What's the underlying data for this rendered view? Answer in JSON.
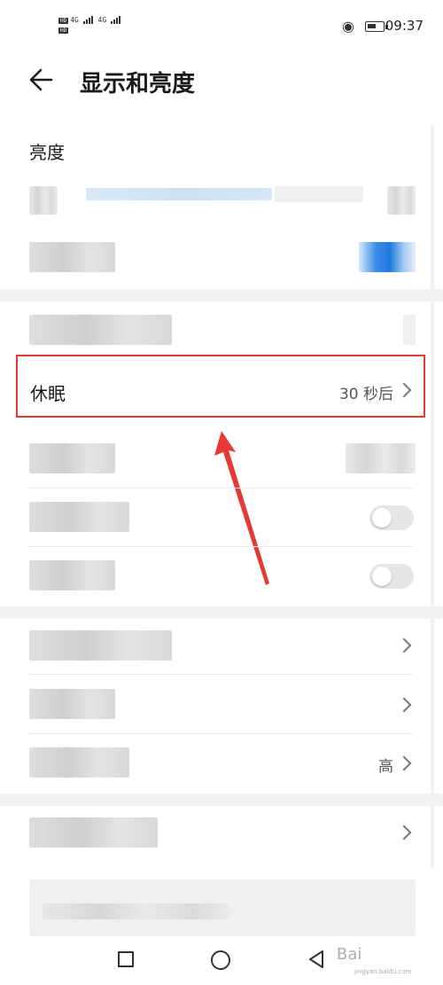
{
  "status_bar": {
    "hd1": "HD",
    "hd2": "HD",
    "net1": "4G",
    "net2": "4G",
    "time": "09:37",
    "icons": [
      "eye-icon",
      "battery-icon",
      "signal-icon"
    ]
  },
  "header": {
    "back_icon": "arrow-left-icon",
    "title": "显示和亮度"
  },
  "brightness_section": {
    "title": "亮度"
  },
  "sleep_row": {
    "label": "休眠",
    "value": "30 秒后"
  },
  "row_high": {
    "value": "高"
  },
  "colors": {
    "highlight": "#e53935",
    "arrow": "#e53935",
    "accent": "#1f7ae0"
  },
  "nav": {
    "icons": [
      "recent-apps-icon",
      "home-icon",
      "back-triangle-icon"
    ]
  },
  "watermark": {
    "text": "Bai",
    "sub": "jingyan.baidu.com"
  }
}
